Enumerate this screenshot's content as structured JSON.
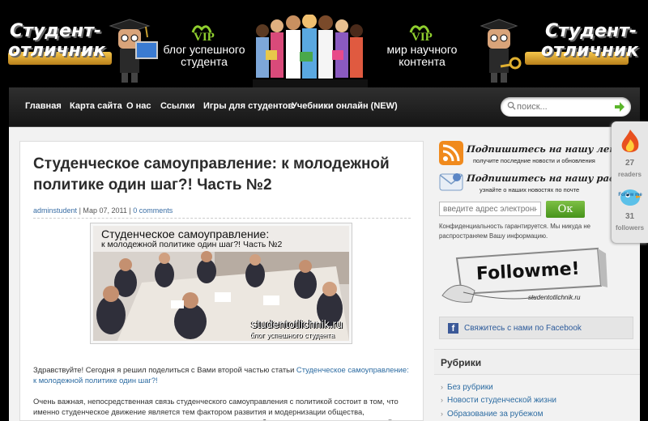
{
  "header": {
    "brand_line1": "Студент-",
    "brand_line2": "отличник",
    "vip_label": "VIP",
    "tagline_left": "блог успешного студента",
    "tagline_right": "мир научного контента",
    "brand_color": "#8fce2e"
  },
  "nav": {
    "items": [
      "Главная",
      "Карта сайта",
      "О нас",
      "Ссылки",
      "Игры для студентов",
      "Учебники онлайн (NEW)"
    ],
    "search_placeholder": "поиск..."
  },
  "post": {
    "title": "Студенческое самоуправление: к молодежной политике один шаг?! Часть №2",
    "author": "adminstudent",
    "date": "Мар 07, 2011",
    "comments": "0 comments",
    "image": {
      "title_line1": "Студенческое самоуправление:",
      "title_line2": "к молодежной политике один шаг?! Часть №2",
      "site": "studentotlichnik.ru",
      "site_sub": "блог успешного студента"
    },
    "intro": "Здравствуйте! Сегодня я решил поделиться с Вами второй частью статьи ",
    "intro_link": "Студенческое самоуправление: к молодежной политике один шаг?!",
    "body": "Очень важная, непосредственная связь студенческого самоуправления с политикой состоит в том, что именно студенческое движение является тем фактором развития и модернизации общества, проявляющего потенциальных лидеров, дает возможность выработать у них навыки управленческой и организаторской работы с коллективом, и, что самое главное среди этого, формирует будущую элиту"
  },
  "sidebar": {
    "rss_title": "Подпишитесь на нашу ленту",
    "rss_note": "получите последние новости и обновления",
    "mail_title": "Подпишитесь на нашу рассылку",
    "mail_note": "узнайте о наших новостях по почте",
    "email_placeholder": "введите адрес электронной почты",
    "ok_label": "Ок",
    "privacy": "Конфиденциальность гарантируется. Мы никуда не распространяем Вашу информацию.",
    "followme_label": "Followme!",
    "followme_user": "studentotlichnik.ru",
    "facebook_label": "Свяжитесь с нами по Facebook",
    "rubrics_title": "Рубрики",
    "categories": [
      "Без рубрики",
      "Новости студенческой жизни",
      "Образование за рубежом"
    ]
  },
  "counter": {
    "readers_count": "27",
    "readers_label": "readers",
    "followers_count": "31",
    "followers_label": "followers",
    "followme_badge": "Follow me"
  }
}
